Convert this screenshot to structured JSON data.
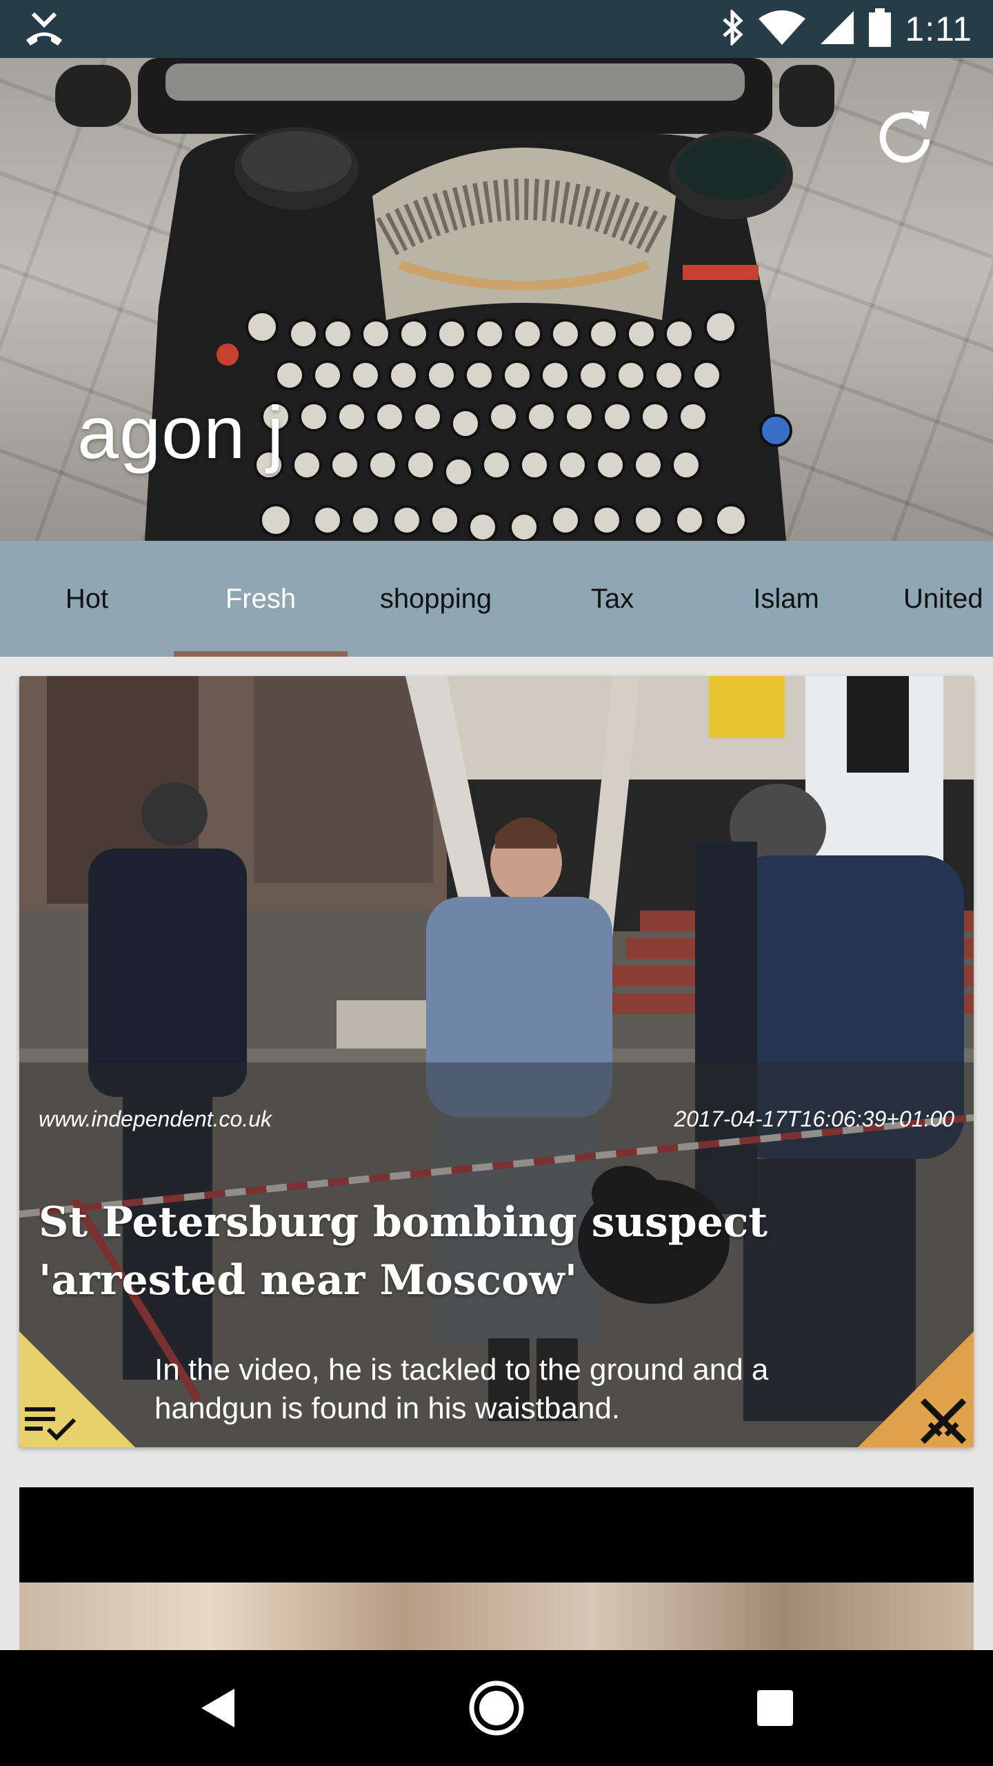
{
  "status_bar": {
    "time": "1:11",
    "icons": [
      "missed-call-icon",
      "bluetooth-icon",
      "wifi-icon",
      "cell-signal-icon",
      "battery-icon"
    ]
  },
  "header": {
    "title": "agon j",
    "refresh_icon": "refresh-icon"
  },
  "tabs": {
    "items": [
      {
        "label": "Hot"
      },
      {
        "label": "Fresh"
      },
      {
        "label": "shopping"
      },
      {
        "label": "Tax"
      },
      {
        "label": "Islam"
      },
      {
        "label": "United"
      }
    ],
    "active": "Fresh",
    "indicator_color": "#8d6552",
    "background_color": "#8fa6b3"
  },
  "cards": [
    {
      "source": "www.independent.co.uk",
      "date": "2017-04-17T16:06:39+01:00",
      "title": "St Petersburg bombing suspect 'arrested near Moscow'",
      "description": "In the video, he is tackled to the ground and a handgun is found in his waistband.",
      "left_action_icon": "playlist-check-icon",
      "left_action_color": "#e8d16a",
      "right_action_icon": "crossed-swords-icon",
      "right_action_color": "#e0a24a"
    }
  ],
  "nav_bar": {
    "icons": [
      "back-icon",
      "home-icon",
      "recents-icon"
    ]
  }
}
